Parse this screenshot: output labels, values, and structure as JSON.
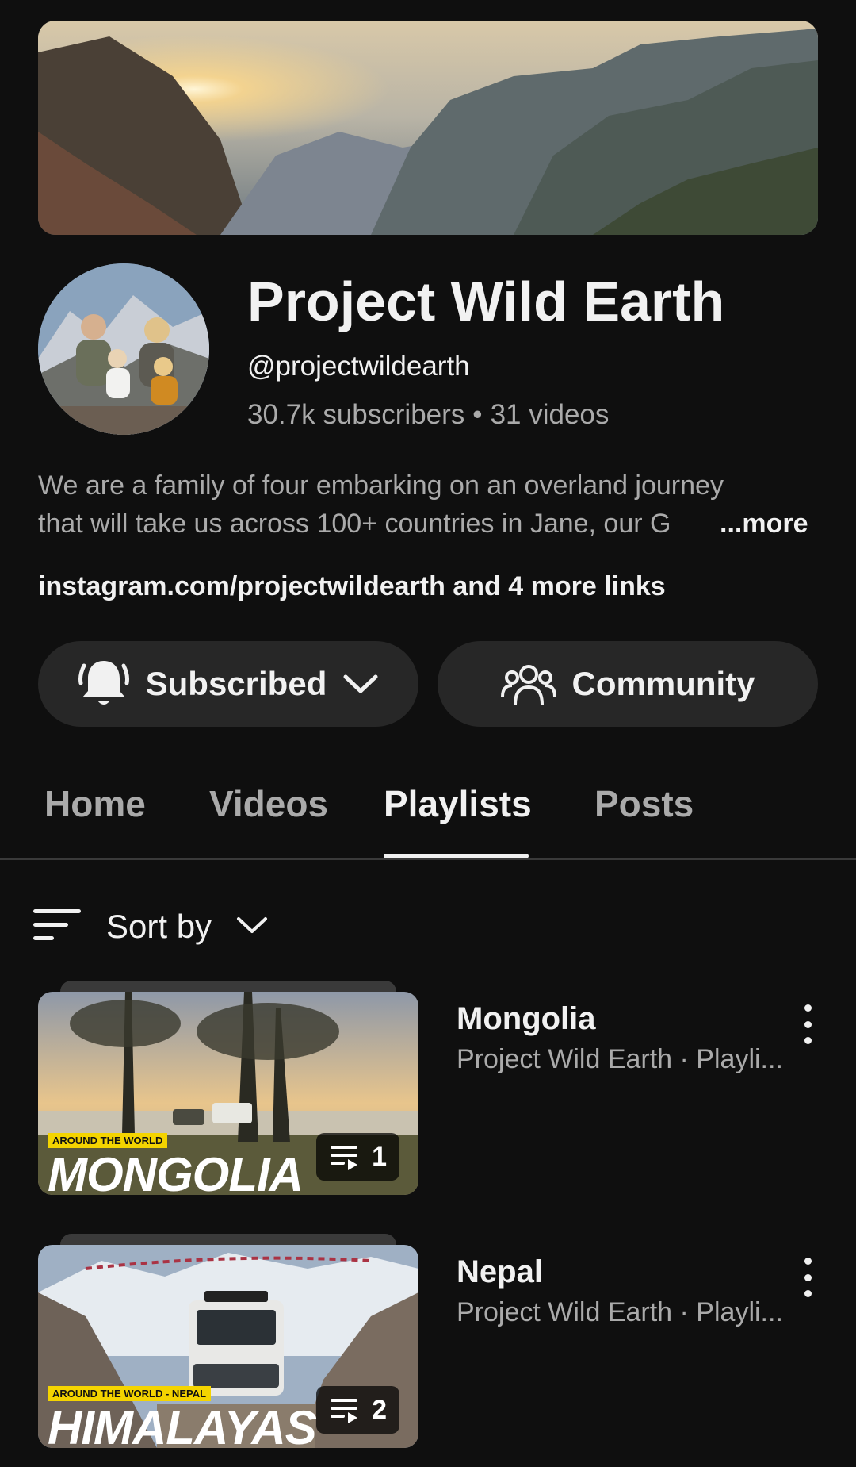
{
  "channel": {
    "title": "Project Wild Earth",
    "handle": "@projectwildearth",
    "subscribers": "30.7k subscribers",
    "separator": "•",
    "videos": "31 videos",
    "description_line1": "We are a family of four embarking on an overland journey",
    "description_line2": "that will take us across 100+ countries in Jane, our G",
    "more_label": "...more",
    "link_main": "instagram.com/projectwildearth",
    "link_rest": " and 4 more links"
  },
  "actions": {
    "subscribed_label": "Subscribed",
    "subscribed_icon": "bell-icon",
    "community_label": "Community",
    "community_icon": "people-icon"
  },
  "tabs": [
    {
      "label": "Home",
      "active": false
    },
    {
      "label": "Videos",
      "active": false
    },
    {
      "label": "Playlists",
      "active": true
    },
    {
      "label": "Posts",
      "active": false
    }
  ],
  "sort": {
    "label": "Sort by",
    "icon": "sort-icon"
  },
  "playlists": [
    {
      "title": "Mongolia",
      "subtitle": "Project Wild Earth · Playli...",
      "count": "1",
      "thumb_kicker": "AROUND THE WORLD",
      "thumb_title": "MONGOLIA"
    },
    {
      "title": "Nepal",
      "subtitle": "Project Wild Earth · Playli...",
      "count": "2",
      "thumb_kicker": "AROUND THE WORLD - NEPAL",
      "thumb_title": "HIMALAYAS"
    }
  ],
  "colors": {
    "background": "#0f0f0f",
    "button_bg": "#272727",
    "secondary_text": "#aaaaaa",
    "primary_text": "#f1f1f1"
  }
}
